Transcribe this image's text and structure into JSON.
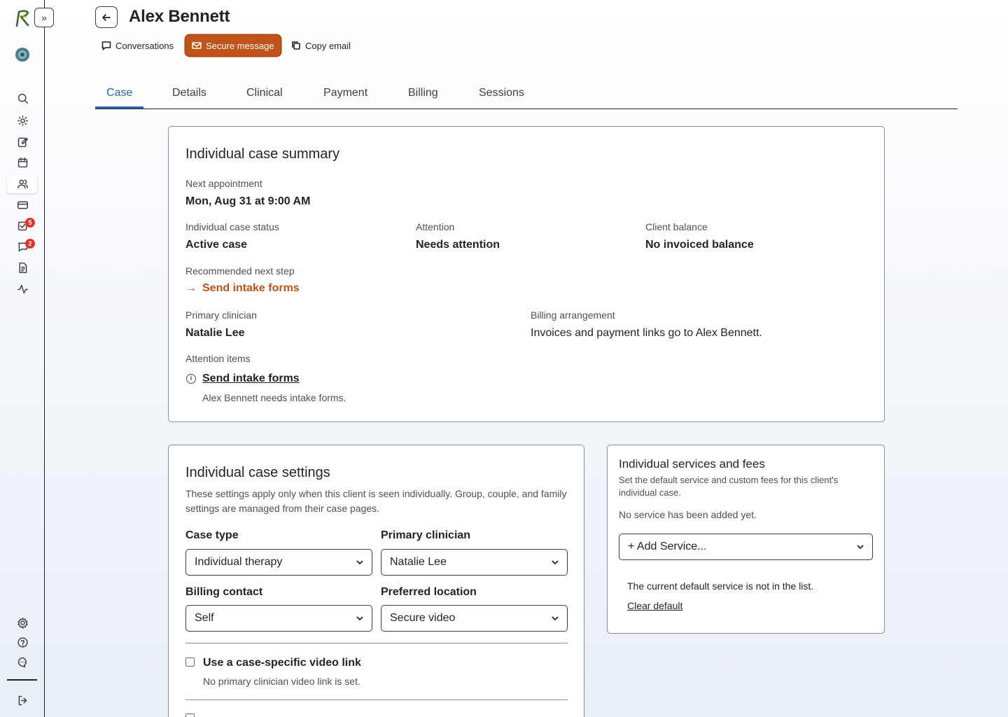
{
  "sidebar": {
    "toggle_label": "»",
    "badges": {
      "tasks": "5",
      "messages": "2"
    }
  },
  "header": {
    "title": "Alex Bennett",
    "actions": {
      "conversations": "Conversations",
      "secure_message": "Secure message",
      "copy_email": "Copy email"
    }
  },
  "tabs": [
    "Case",
    "Details",
    "Clinical",
    "Payment",
    "Billing",
    "Sessions"
  ],
  "summary": {
    "heading": "Individual case summary",
    "next_appointment_label": "Next appointment",
    "next_appointment_value": "Mon, Aug 31 at 9:00 AM",
    "status_label": "Individual case status",
    "status_value": "Active case",
    "attention_label": "Attention",
    "attention_value": "Needs attention",
    "balance_label": "Client balance",
    "balance_value": "No invoiced balance",
    "next_step_label": "Recommended next step",
    "next_step_value": "Send intake forms",
    "clinician_label": "Primary clinician",
    "clinician_value": "Natalie Lee",
    "billing_label": "Billing arrangement",
    "billing_value": "Invoices and payment links go to Alex Bennett.",
    "attention_items_label": "Attention items",
    "attention_item_title": "Send intake forms",
    "attention_item_desc": "Alex Bennett needs intake forms."
  },
  "settings": {
    "heading": "Individual case settings",
    "description": "These settings apply only when this client is seen individually. Group, couple, and family settings are managed from their case pages.",
    "case_type_label": "Case type",
    "case_type_value": "Individual therapy",
    "clinician_label": "Primary clinician",
    "clinician_value": "Natalie Lee",
    "billing_contact_label": "Billing contact",
    "billing_contact_value": "Self",
    "location_label": "Preferred location",
    "location_value": "Secure video",
    "video_link_label": "Use a case-specific video link",
    "video_link_desc": "No primary clinician video link is set."
  },
  "services": {
    "heading": "Individual services and fees",
    "description": "Set the default service and custom fees for this client's individual case.",
    "empty_text": "No service has been added yet.",
    "add_service": "+ Add Service...",
    "default_note": "The current default service is not in the list.",
    "clear_default": "Clear default"
  }
}
